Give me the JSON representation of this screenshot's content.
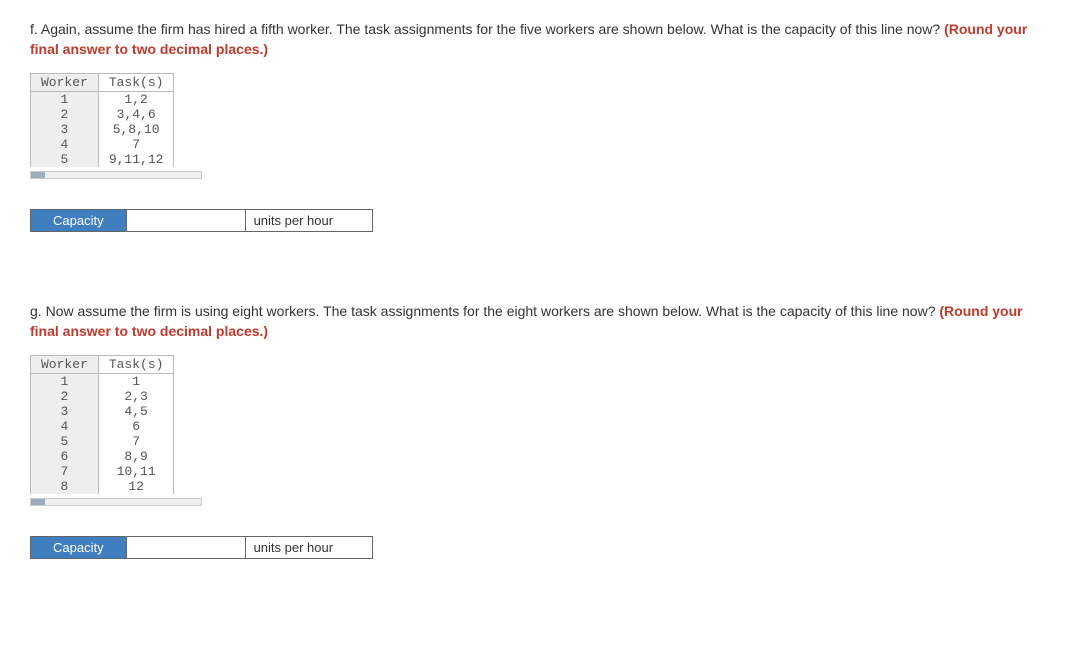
{
  "f": {
    "prompt": "f. Again, assume the firm has hired a fifth worker. The task assignments for the five workers are shown below. What is the capacity of this line now? ",
    "instruction": "(Round your final answer to two decimal places.)",
    "headers": [
      "Worker",
      "Task(s)"
    ],
    "rows": [
      [
        "1",
        "1,2"
      ],
      [
        "2",
        "3,4,6"
      ],
      [
        "3",
        "5,8,10"
      ],
      [
        "4",
        "7"
      ],
      [
        "5",
        "9,11,12"
      ]
    ],
    "answer_label": "Capacity",
    "answer_value": "",
    "answer_unit": "units per hour"
  },
  "g": {
    "prompt": "g. Now assume the firm is using eight workers. The task assignments for the eight workers are shown below. What is the capacity of this line now? ",
    "instruction": "(Round your final answer to two decimal places.)",
    "headers": [
      "Worker",
      "Task(s)"
    ],
    "rows": [
      [
        "1",
        "1"
      ],
      [
        "2",
        "2,3"
      ],
      [
        "3",
        "4,5"
      ],
      [
        "4",
        "6"
      ],
      [
        "5",
        "7"
      ],
      [
        "6",
        "8,9"
      ],
      [
        "7",
        "10,11"
      ],
      [
        "8",
        "12"
      ]
    ],
    "answer_label": "Capacity",
    "answer_value": "",
    "answer_unit": "units per hour"
  }
}
